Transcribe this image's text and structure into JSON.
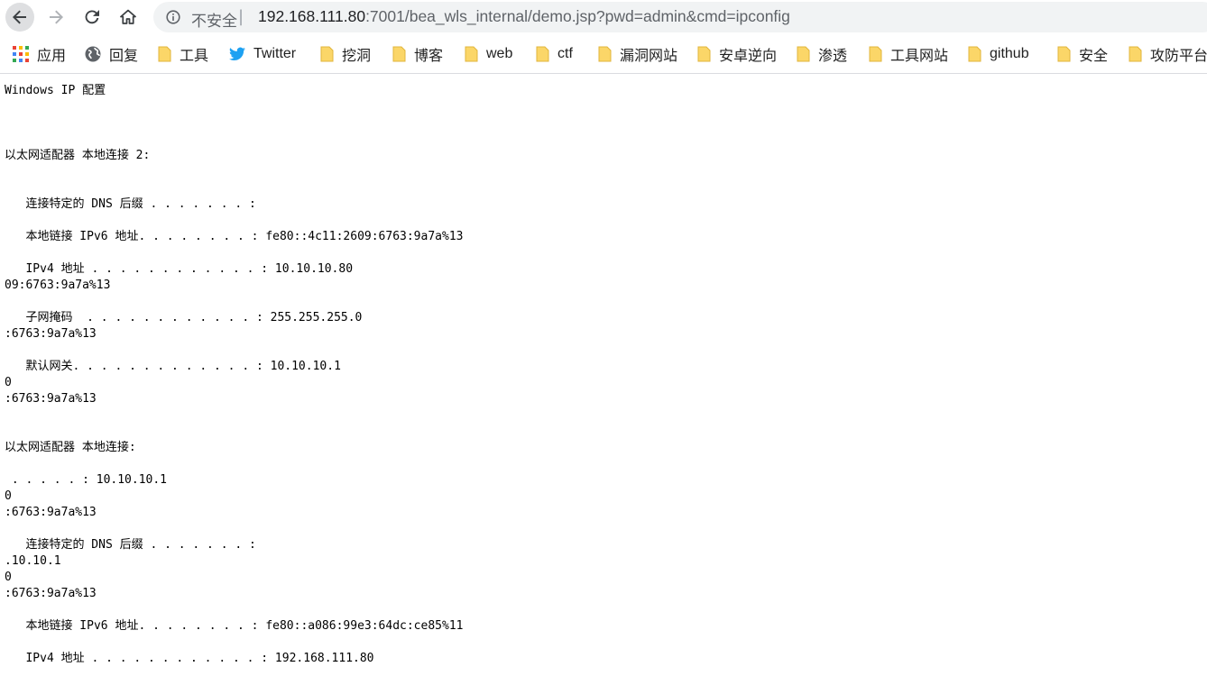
{
  "browser": {
    "security_label": "不安全",
    "security_separator": "|",
    "url_host": "192.168.111.80",
    "url_rest": ":7001/bea_wls_internal/demo.jsp?pwd=admin&cmd=ipconfig"
  },
  "bookmarks": [
    {
      "label": "应用",
      "icon": "apps-grid-icon"
    },
    {
      "label": "回复",
      "icon": "globe-icon"
    },
    {
      "label": "工具",
      "icon": "folder-icon"
    },
    {
      "label": "Twitter",
      "icon": "twitter-bird-icon"
    },
    {
      "label": "挖洞",
      "icon": "folder-icon"
    },
    {
      "label": "博客",
      "icon": "folder-icon"
    },
    {
      "label": "web",
      "icon": "folder-icon"
    },
    {
      "label": "ctf",
      "icon": "folder-icon"
    },
    {
      "label": "漏洞网站",
      "icon": "folder-icon"
    },
    {
      "label": "安卓逆向",
      "icon": "folder-icon"
    },
    {
      "label": "渗透",
      "icon": "folder-icon"
    },
    {
      "label": "工具网站",
      "icon": "folder-icon"
    },
    {
      "label": "github",
      "icon": "folder-icon"
    },
    {
      "label": "安全",
      "icon": "folder-icon"
    },
    {
      "label": "攻防平台",
      "icon": "folder-icon"
    }
  ],
  "page": {
    "output": "Windows IP 配置\n\n\n\n以太网适配器 本地连接 2:\n\n\n   连接特定的 DNS 后缀 . . . . . . . :\n\n   本地链接 IPv6 地址. . . . . . . . : fe80::4c11:2609:6763:9a7a%13\n\n   IPv4 地址 . . . . . . . . . . . . : 10.10.10.80\n09:6763:9a7a%13\n\n   子网掩码  . . . . . . . . . . . . : 255.255.255.0\n:6763:9a7a%13\n\n   默认网关. . . . . . . . . . . . . : 10.10.10.1\n0\n:6763:9a7a%13\n\n\n以太网适配器 本地连接:\n\n . . . . . : 10.10.10.1\n0\n:6763:9a7a%13\n\n   连接特定的 DNS 后缀 . . . . . . . :\n.10.10.1\n0\n:6763:9a7a%13\n\n   本地链接 IPv6 地址. . . . . . . . : fe80::a086:99e3:64dc:ce85%11\n\n   IPv4 地址 . . . . . . . . . . . . : 192.168.111.80"
  }
}
